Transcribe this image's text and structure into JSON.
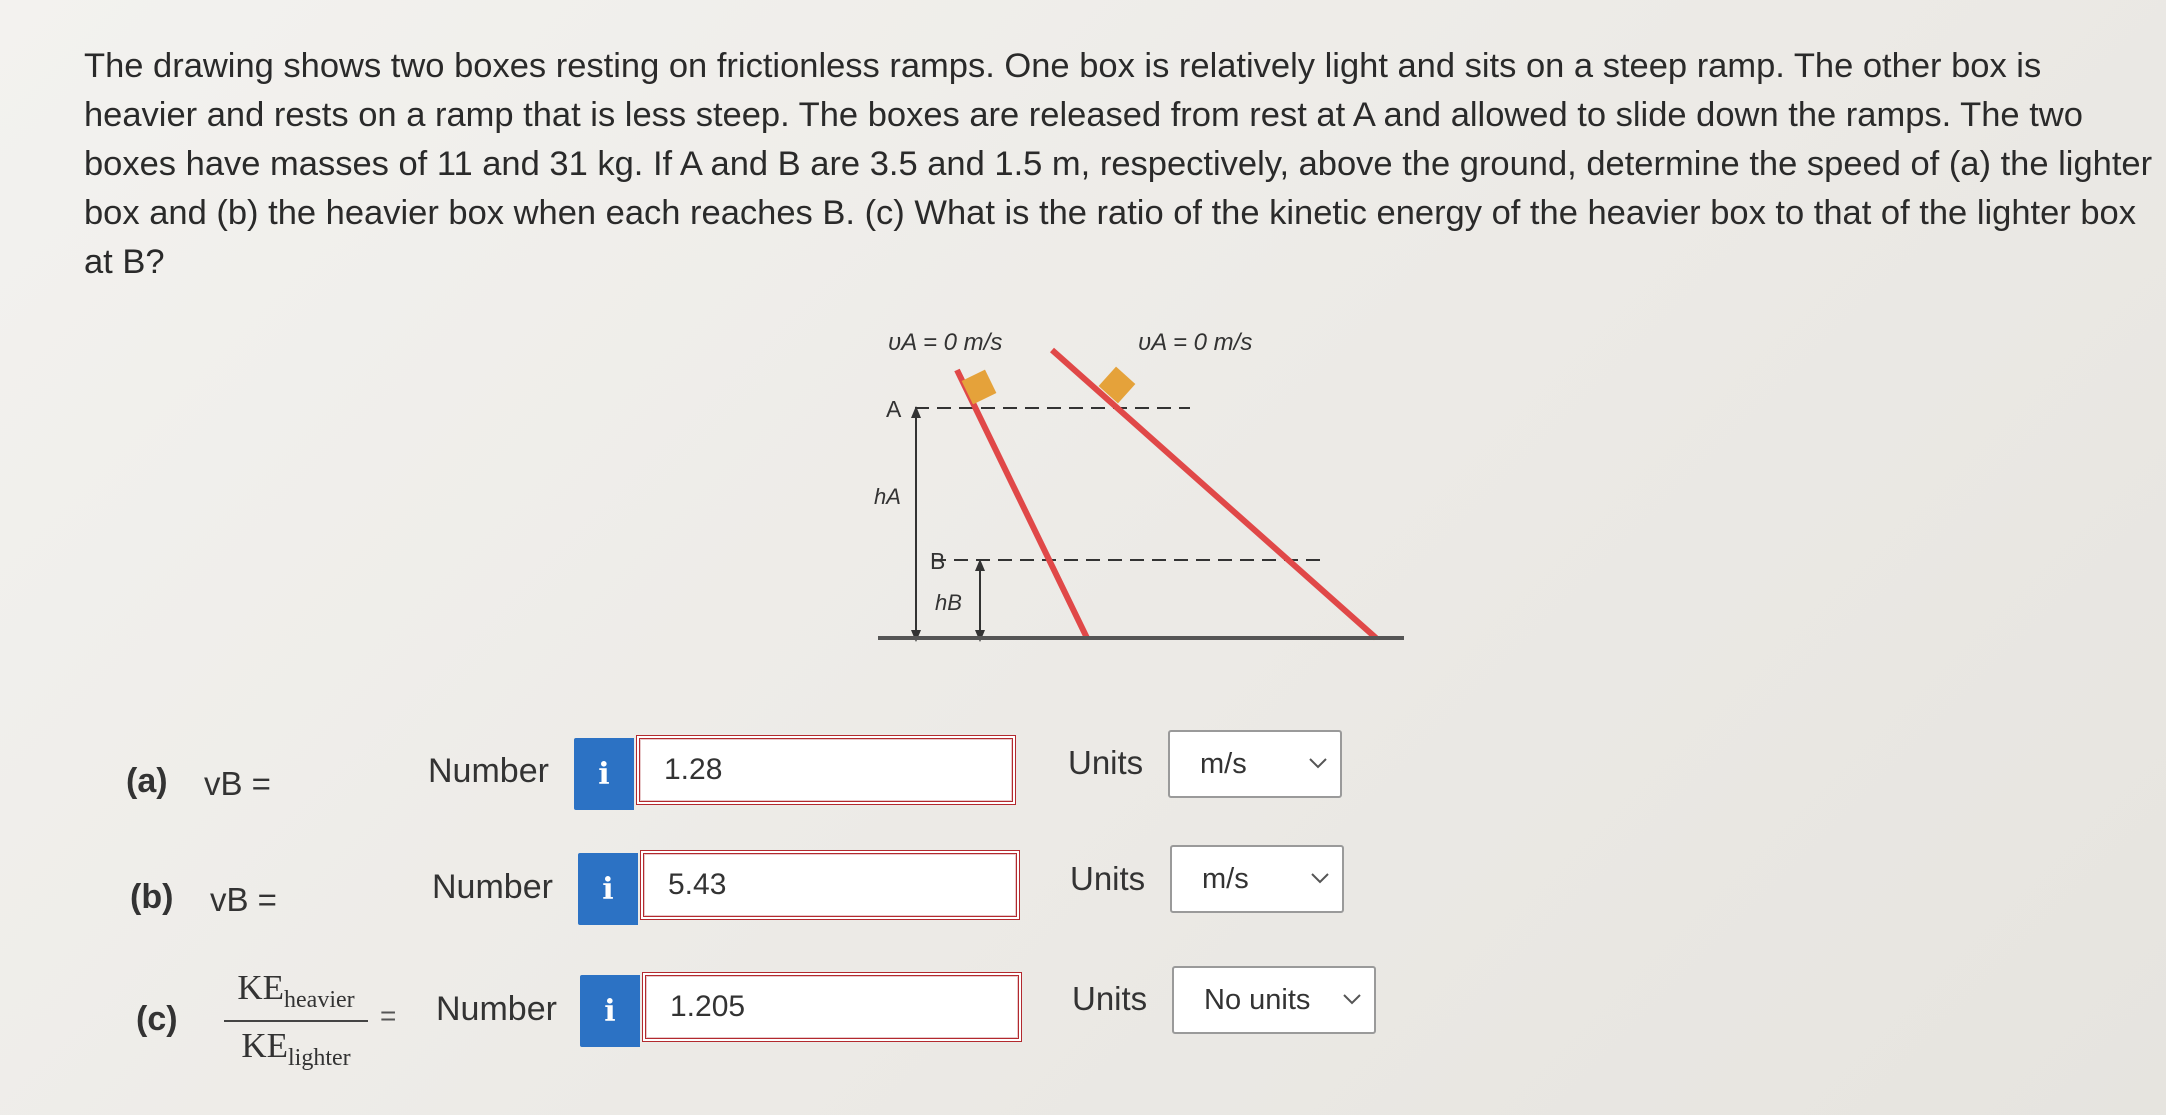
{
  "question": {
    "lines": [
      "The drawing shows two boxes resting on frictionless ramps. One box is relatively light and sits on a steep ramp. The other box is",
      "heavier and rests on a ramp that is less steep. The boxes are released from rest at A and allowed to slide down the ramps. The two",
      "boxes have masses of 11 and 31 kg. If A and B are 3.5 and 1.5 m, respectively, above the ground, determine the speed of (a) the lighter",
      "box and (b) the heavier box when each reaches B. (c) What is the ratio of the kinetic energy of the heavier box to that of the lighter box",
      "at B?"
    ]
  },
  "diagram": {
    "va_left": "υA = 0 m/s",
    "va_right": "υA = 0 m/s",
    "label_a": "A",
    "label_b": "B",
    "label_ha": "hA",
    "label_hb": "hB",
    "colors": {
      "ramp": "#e04848",
      "box": "#e5a23a",
      "ground": "#555555"
    }
  },
  "answers": [
    {
      "part": "(a)",
      "var": "vB =",
      "number_label": "Number",
      "info": "i",
      "value": "1.28",
      "units_label": "Units",
      "unit": "m/s"
    },
    {
      "part": "(b)",
      "var": "vB =",
      "number_label": "Number",
      "info": "i",
      "value": "5.43",
      "units_label": "Units",
      "unit": "m/s"
    },
    {
      "part": "(c)",
      "frac_num": "KE",
      "frac_num_sub": "heavier",
      "frac_den": "KE",
      "frac_den_sub": "lighter",
      "eq": "=",
      "number_label": "Number",
      "info": "i",
      "value": "1.205",
      "units_label": "Units",
      "unit": "No units"
    }
  ],
  "colors": {
    "info_button": "#2c72c4",
    "field_border": "#b3292e"
  }
}
